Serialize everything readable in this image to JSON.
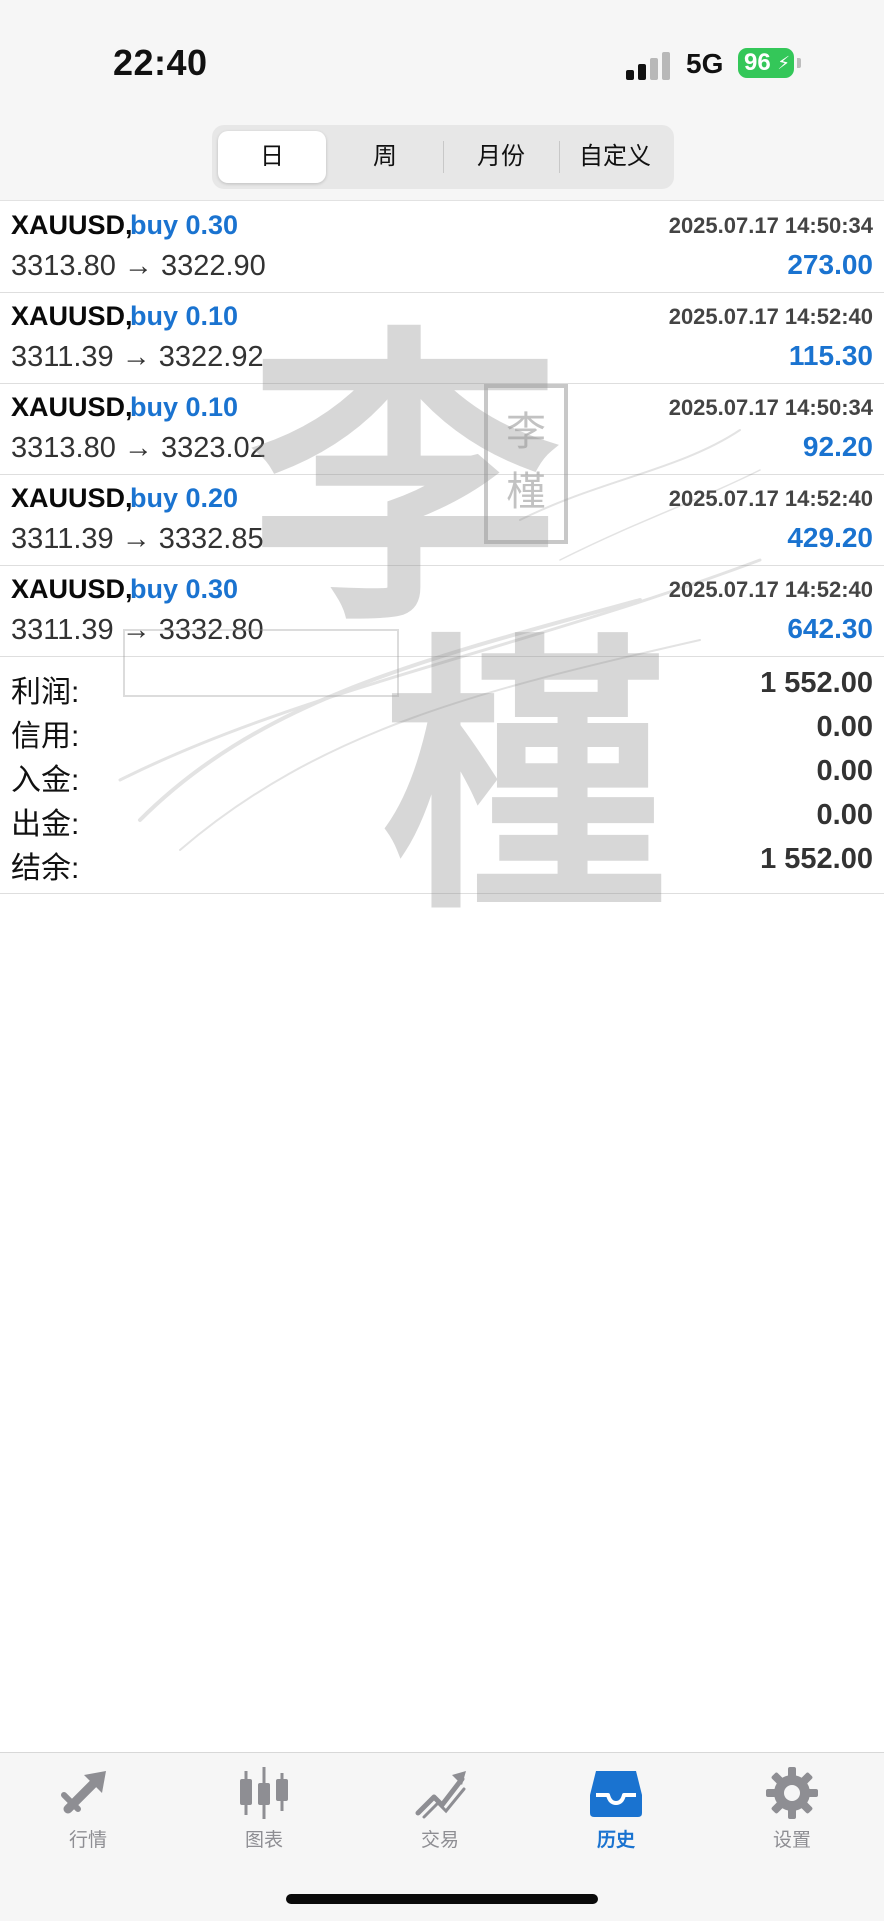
{
  "status_bar": {
    "time": "22:40",
    "network": "5G",
    "battery": "96"
  },
  "segments": [
    {
      "label": "日",
      "active": true
    },
    {
      "label": "周",
      "active": false
    },
    {
      "label": "月份",
      "active": false
    },
    {
      "label": "自定义",
      "active": false
    }
  ],
  "deals": [
    {
      "symbol": "XAUUSD,",
      "type": "buy 0.30",
      "prices": "3313.80 → 3322.90",
      "time": "2025.07.17 14:50:34",
      "profit": "273.00"
    },
    {
      "symbol": "XAUUSD,",
      "type": "buy 0.10",
      "prices": "3311.39 → 3322.92",
      "time": "2025.07.17 14:52:40",
      "profit": "115.30"
    },
    {
      "symbol": "XAUUSD,",
      "type": "buy 0.10",
      "prices": "3313.80 → 3323.02",
      "time": "2025.07.17 14:50:34",
      "profit": "92.20"
    },
    {
      "symbol": "XAUUSD,",
      "type": "buy 0.20",
      "prices": "3311.39 → 3332.85",
      "time": "2025.07.17 14:52:40",
      "profit": "429.20"
    },
    {
      "symbol": "XAUUSD,",
      "type": "buy 0.30",
      "prices": "3311.39 → 3332.80",
      "time": "2025.07.17 14:52:40",
      "profit": "642.30"
    }
  ],
  "summary": [
    {
      "label": "利润:",
      "value": "1 552.00"
    },
    {
      "label": "信用:",
      "value": "0.00"
    },
    {
      "label": "入金:",
      "value": "0.00"
    },
    {
      "label": "出金:",
      "value": "0.00"
    },
    {
      "label": "结余:",
      "value": "1 552.00"
    }
  ],
  "watermark": {
    "large_text": "李槿",
    "seal_text": "李槿"
  },
  "tab_bar": [
    {
      "label": "行情",
      "icon": "trend-arrow-icon",
      "active": false
    },
    {
      "label": "图表",
      "icon": "candlestick-icon",
      "active": false
    },
    {
      "label": "交易",
      "icon": "trade-chart-icon",
      "active": false
    },
    {
      "label": "历史",
      "icon": "history-inbox-icon",
      "active": true
    },
    {
      "label": "设置",
      "icon": "gear-icon",
      "active": false
    }
  ],
  "colors": {
    "accent": "#1a73d0",
    "profit": "#1a73d0",
    "battery": "#34c759",
    "text": "#111111",
    "muted": "#8e8e93"
  }
}
